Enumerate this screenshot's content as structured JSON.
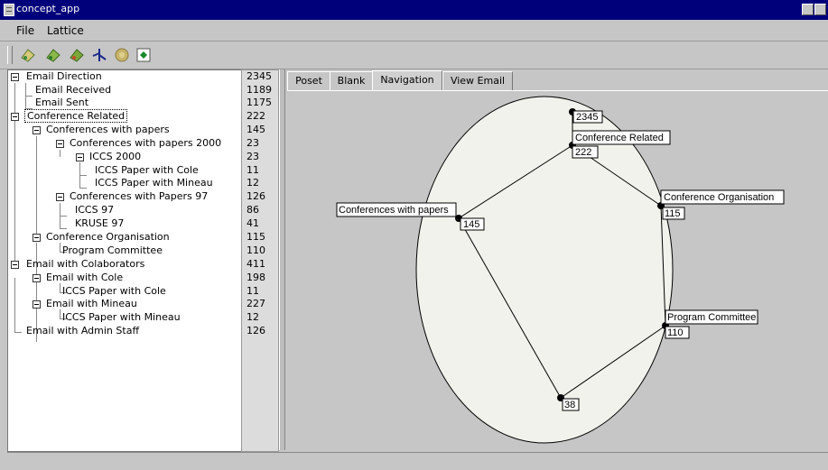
{
  "window": {
    "title": "concept_app"
  },
  "menu": {
    "file": "File",
    "lattice": "Lattice"
  },
  "toolbar": {
    "buttons": [
      "bookmark-icon",
      "bookmark-add-icon",
      "bookmark-remove-icon",
      "lattice-icon",
      "circle-icon",
      "diamond-icon"
    ]
  },
  "tree": [
    {
      "label": "Email Direction",
      "count": "2345"
    },
    {
      "label": "Email Received",
      "count": "1189"
    },
    {
      "label": "Email Sent",
      "count": "1175"
    },
    {
      "label": "Conference Related",
      "count": "222"
    },
    {
      "label": "Conferences with papers",
      "count": "145"
    },
    {
      "label": "Conferences with papers 2000",
      "count": "23"
    },
    {
      "label": "ICCS 2000",
      "count": "23"
    },
    {
      "label": "ICCS Paper with Cole",
      "count": "11"
    },
    {
      "label": "ICCS Paper with Mineau",
      "count": "12"
    },
    {
      "label": "Conferences with Papers 97",
      "count": "126"
    },
    {
      "label": "ICCS 97",
      "count": "86"
    },
    {
      "label": "KRUSE 97",
      "count": "41"
    },
    {
      "label": "Conference Organisation",
      "count": "115"
    },
    {
      "label": "Program Committee",
      "count": "110"
    },
    {
      "label": "Email with Colaborators",
      "count": "411"
    },
    {
      "label": "Email with Cole",
      "count": "198"
    },
    {
      "label": "ICCS Paper with Cole",
      "count": "11"
    },
    {
      "label": "Email with Mineau",
      "count": "227"
    },
    {
      "label": "ICCS Paper with Mineau",
      "count": "12"
    },
    {
      "label": "Email with Admin Staff",
      "count": "126"
    }
  ],
  "tabs": [
    "Poset",
    "Blank",
    "Navigation",
    "View Email"
  ],
  "active_tab": "Navigation",
  "diagram": {
    "nodes": [
      {
        "id": "top",
        "count": "2345"
      },
      {
        "id": "conf",
        "label": "Conference Related",
        "count": "222"
      },
      {
        "id": "papers",
        "label": "Conferences with papers",
        "count": "145"
      },
      {
        "id": "org",
        "label": "Conference Organisation",
        "count": "115"
      },
      {
        "id": "pc",
        "label": "Program Committee",
        "count": "110"
      },
      {
        "id": "bottom",
        "count": "38"
      }
    ]
  }
}
